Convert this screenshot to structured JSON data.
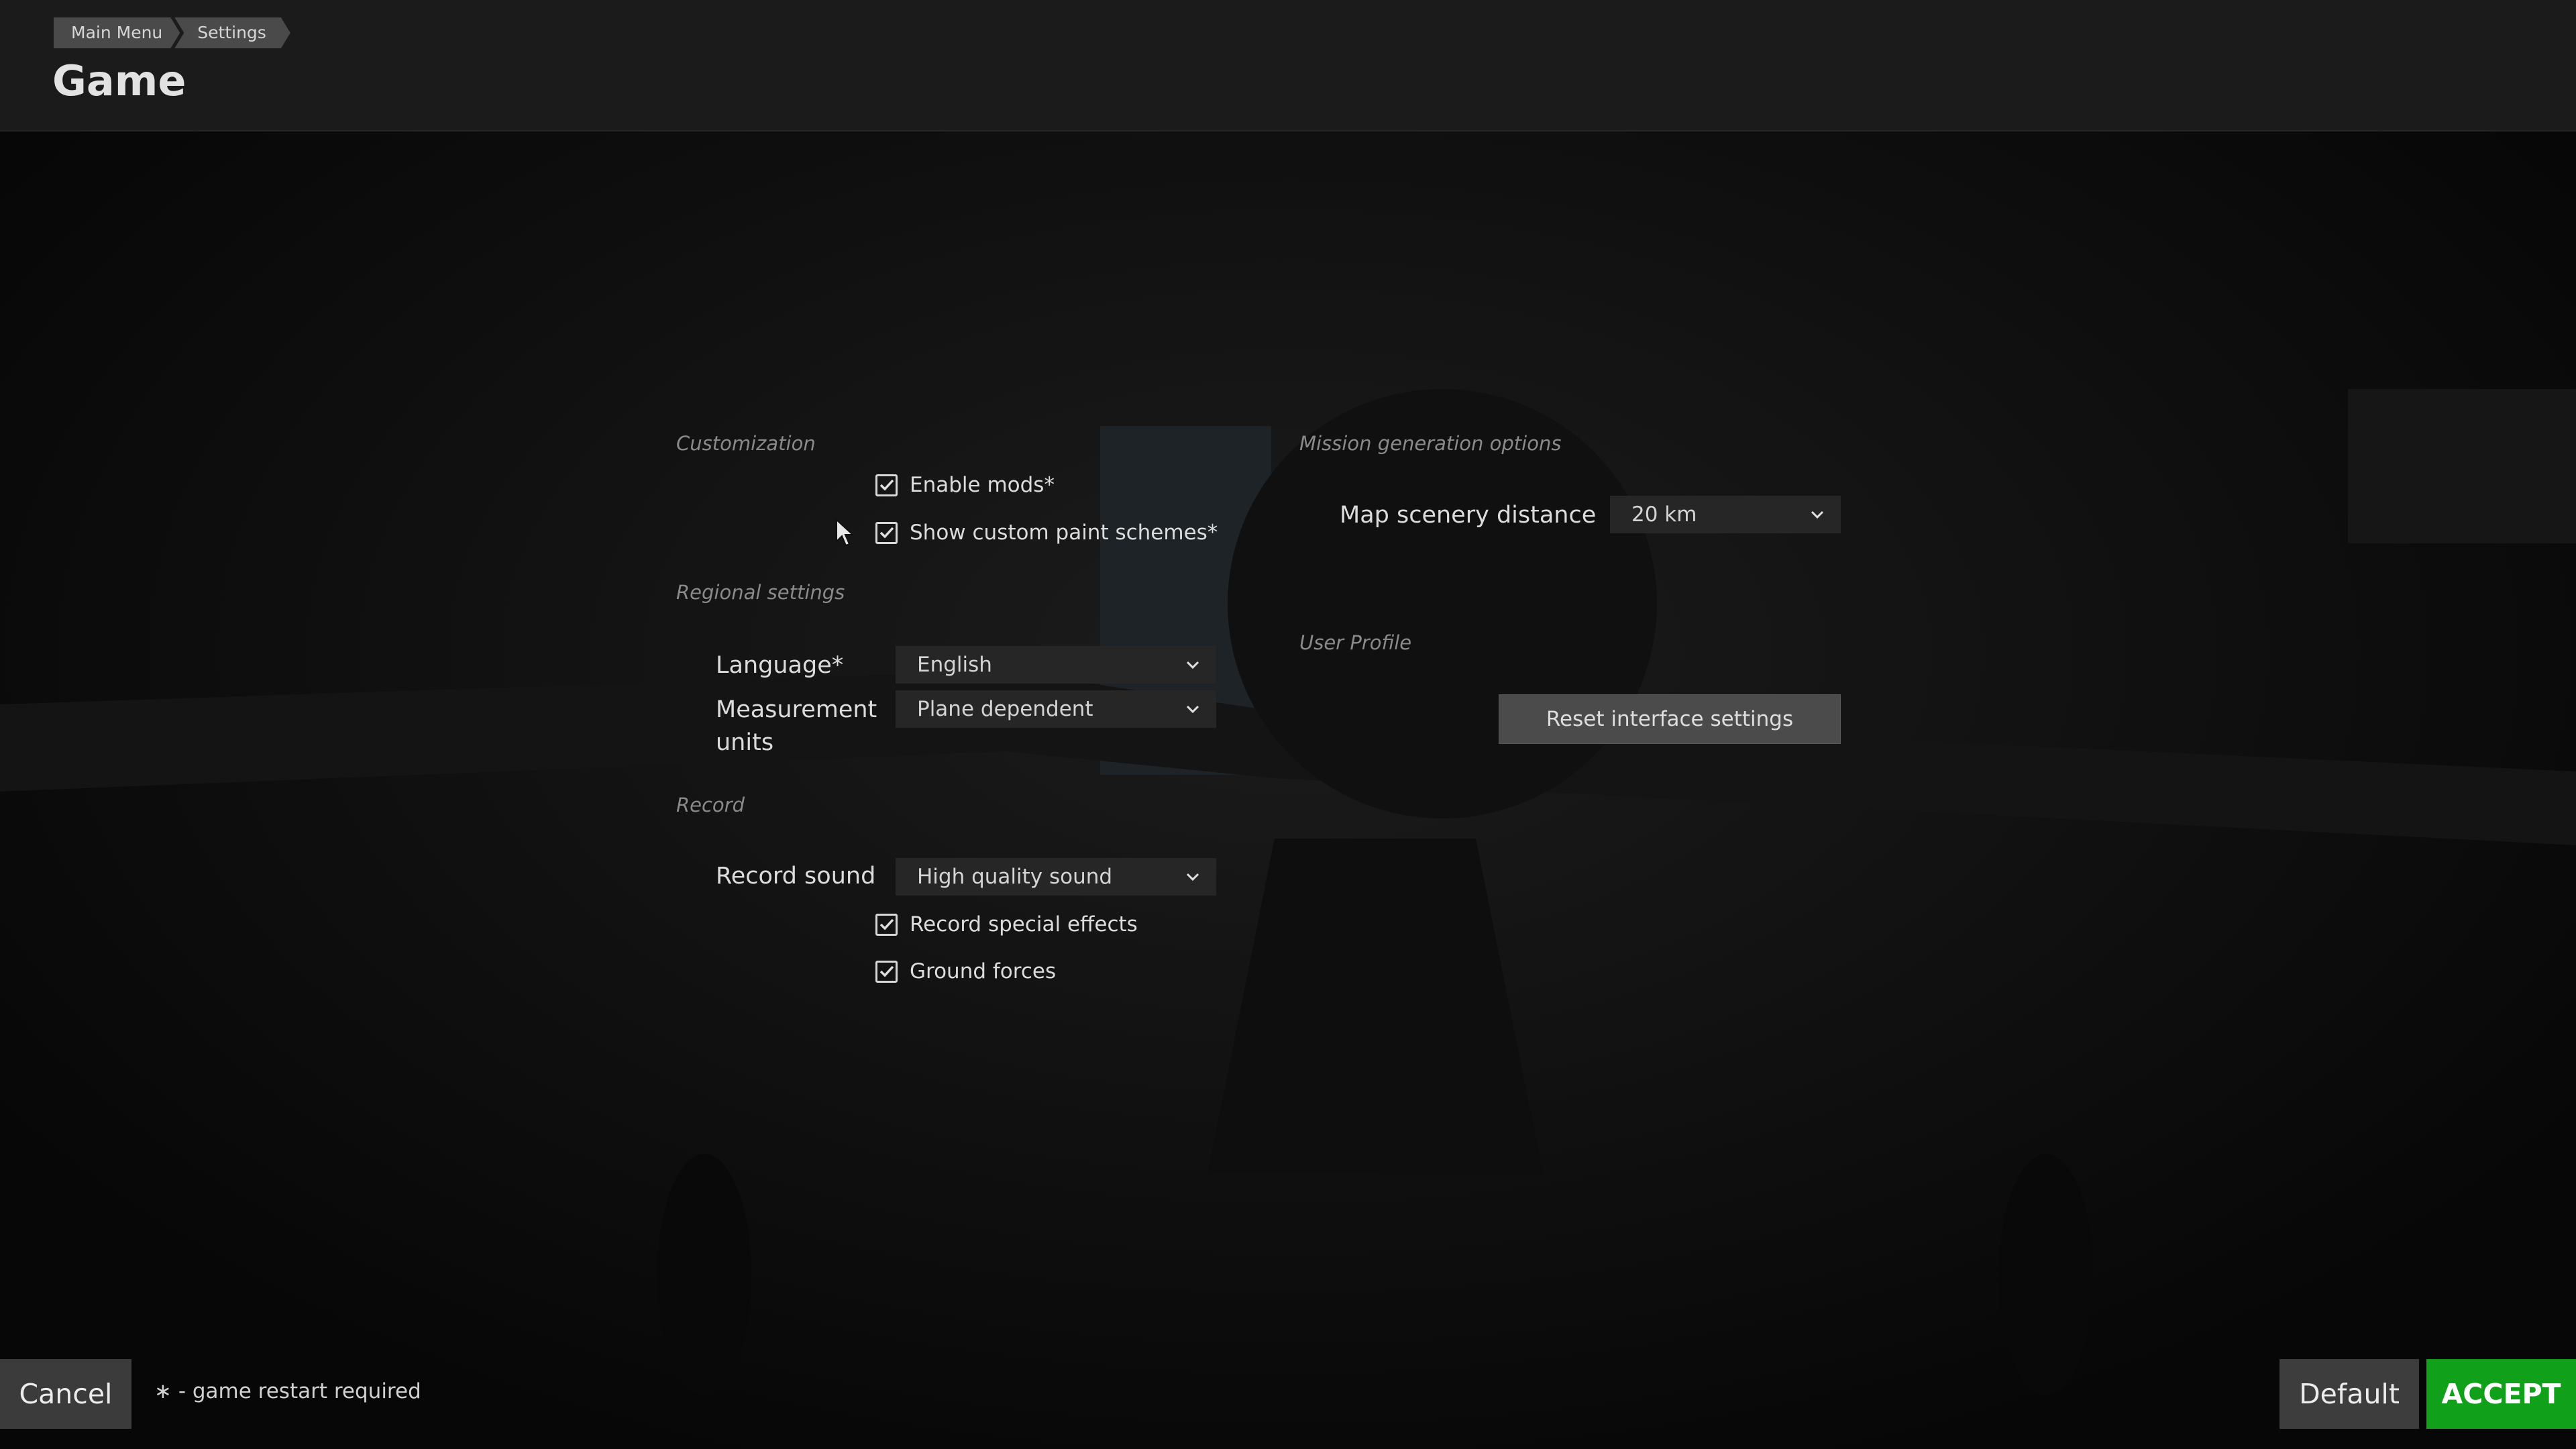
{
  "breadcrumb": [
    "Main Menu",
    "Settings"
  ],
  "page_title": "Game",
  "customization": {
    "label": "Customization",
    "enable_mods": {
      "label": "Enable mods*",
      "checked": true
    },
    "custom_paint": {
      "label": "Show custom paint schemes*",
      "checked": true
    }
  },
  "regional": {
    "label": "Regional settings",
    "language_label": "Language*",
    "language_value": "English",
    "units_label": "Measurement units",
    "units_value": "Plane dependent"
  },
  "record": {
    "label": "Record",
    "sound_label": "Record sound",
    "sound_value": "High quality sound",
    "special_effects": {
      "label": "Record special effects",
      "checked": true
    },
    "ground_forces": {
      "label": "Ground forces",
      "checked": true
    }
  },
  "mission": {
    "label": "Mission generation options",
    "scenery_label": "Map scenery distance",
    "scenery_value": "20 km"
  },
  "profile": {
    "label": "User Profile",
    "reset_label": "Reset interface settings"
  },
  "footer": {
    "cancel": "Cancel",
    "note": "∗ - game restart required",
    "default": "Default",
    "accept": "ACCEPT"
  },
  "colors": {
    "accept": "#10a019",
    "background": "#0b0b0b"
  }
}
